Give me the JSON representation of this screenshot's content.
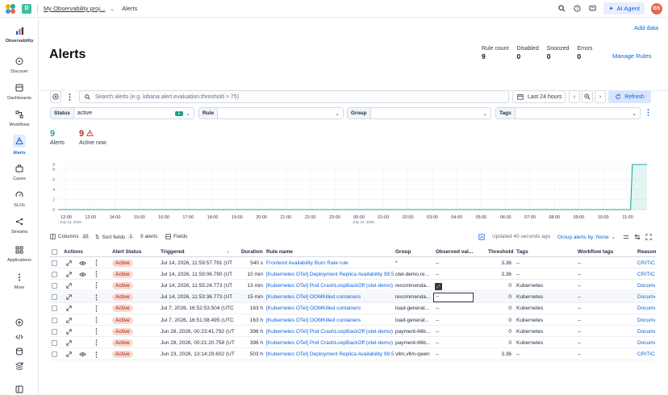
{
  "header": {
    "space_badge": "D",
    "project": "My Observability proj...",
    "breadcrumb": "Alerts",
    "ai_button": "AI Agent",
    "avatar": "BS"
  },
  "sidenav": {
    "items": [
      {
        "label": "Observability",
        "icon": "observability-icon"
      },
      {
        "label": "Discover",
        "icon": "discover-icon"
      },
      {
        "label": "Dashboards",
        "icon": "dashboards-icon"
      },
      {
        "label": "Workflows",
        "icon": "workflows-icon"
      },
      {
        "label": "Alerts",
        "icon": "alerts-icon"
      },
      {
        "label": "Cases",
        "icon": "cases-icon"
      },
      {
        "label": "SLOs",
        "icon": "slos-icon"
      },
      {
        "label": "Streams",
        "icon": "streams-icon"
      },
      {
        "label": "Applications",
        "icon": "applications-icon"
      },
      {
        "label": "More",
        "icon": "more-icon"
      }
    ]
  },
  "page": {
    "add_data": "Add data",
    "title": "Alerts",
    "stats": [
      {
        "label": "Rule count",
        "value": "9"
      },
      {
        "label": "Disabled",
        "value": "0"
      },
      {
        "label": "Snoozed",
        "value": "0"
      },
      {
        "label": "Errors",
        "value": "0"
      }
    ],
    "manage_rules": "Manage Rules"
  },
  "search": {
    "placeholder": "Search alerts (e.g. kibana.alert.evaluation.threshold > 75)",
    "date_range": "Last 24 hours",
    "refresh": "Refresh"
  },
  "filters": {
    "status_label": "Status",
    "status_value": "active",
    "status_count": "1",
    "rule_label": "Rule",
    "group_label": "Group",
    "tags_label": "Tags"
  },
  "summary": {
    "alerts_value": "9",
    "alerts_label": "Alerts",
    "active_value": "9",
    "active_label": "Active now",
    "alerts_color": "#1ba9a0",
    "active_color": "#bd271e"
  },
  "chart_data": {
    "type": "area",
    "x_ticks": [
      "12:00",
      "13:00",
      "14:00",
      "15:00",
      "16:00",
      "17:00",
      "18:00",
      "19:00",
      "20:00",
      "21:00",
      "22:00",
      "23:00",
      "00:00",
      "01:00",
      "02:00",
      "03:00",
      "04:00",
      "05:00",
      "06:00",
      "07:00",
      "08:00",
      "09:00",
      "10:00",
      "11:00"
    ],
    "x_subticks": [
      "July 13, 2026",
      "July 14, 2026"
    ],
    "y_ticks": [
      0,
      2,
      4,
      6,
      8,
      9
    ],
    "ylim": [
      0,
      9
    ],
    "series": [
      {
        "color": "#1ba9a0",
        "points": [
          [
            0,
            0
          ],
          [
            0.955,
            0
          ],
          [
            0.96,
            0
          ],
          [
            0.972,
            0
          ],
          [
            0.975,
            9
          ],
          [
            1,
            9
          ]
        ]
      }
    ],
    "grid": true
  },
  "toolbar": {
    "columns_label": "Columns",
    "columns_count": "10",
    "sort_label": "Sort fields",
    "sort_count": "1",
    "alerts_count": "9 alerts",
    "fields_label": "Fields",
    "updated": "Updated 40 seconds ago",
    "group_by": "Group alerts by: None"
  },
  "table": {
    "headers": {
      "actions": "Actions",
      "status": "Alert Status",
      "triggered": "Triggered",
      "duration": "Duration",
      "rule": "Rule name",
      "group": "Group",
      "observed": "Observed val...",
      "threshold": "Threshold",
      "tags": "Tags",
      "wf_tags": "Workflow tags",
      "reason": "Reason"
    },
    "rows": [
      {
        "status": "Active",
        "triggered": "Jul 14, 2026, 11:59:57.791 (UT",
        "duration": "540 s",
        "rule": "Frontend Availability Burn Rate rule",
        "group": "*",
        "observed": "--",
        "threshold": "3.36",
        "tags": "--",
        "wf_tags": "--",
        "reason": "CRITICA",
        "eye": true
      },
      {
        "status": "Active",
        "triggered": "Jul 14, 2026, 11:59:06.790 (UT",
        "duration": "10 min",
        "rule": "[Kubernetes OTel] Deployment Replica Availability 99.5",
        "group": "otel-demo,re...",
        "observed": "--",
        "threshold": "3.36",
        "tags": "--",
        "wf_tags": "--",
        "reason": "CRITICA",
        "eye": true
      },
      {
        "status": "Active",
        "triggered": "Jul 14, 2026, 11:55:24.773 (UT",
        "duration": "13 min",
        "rule": "[Kubernetes OTel] Pod CrashLoopBackOff (otel-demo)",
        "group": "recommenda...",
        "observed": "",
        "threshold": "0",
        "tags": "Kubernetes",
        "wf_tags": "--",
        "reason": "Docume",
        "eye": false
      },
      {
        "status": "Active",
        "triggered": "Jul 14, 2026, 11:53:36.773 (UT",
        "duration": "15 min",
        "rule": "[Kubernetes OTel] OOMKilled containers",
        "group": "recommenda...",
        "observed": "--",
        "threshold": "0",
        "tags": "Kubernetes",
        "wf_tags": "--",
        "reason": "Docume",
        "eye": false
      },
      {
        "status": "Active",
        "triggered": "Jul 7, 2026, 16:52:53.504 (UTC",
        "duration": "163 h",
        "rule": "[Kubernetes OTel] OOMKilled containers",
        "group": "load-generat...",
        "observed": "--",
        "threshold": "0",
        "tags": "Kubernetes",
        "wf_tags": "--",
        "reason": "Docume",
        "eye": false
      },
      {
        "status": "Active",
        "triggered": "Jul 7, 2026, 16:51:08.495 (UTC",
        "duration": "163 h",
        "rule": "[Kubernetes OTel] OOMKilled containers",
        "group": "load-generat...",
        "observed": "--",
        "threshold": "0",
        "tags": "Kubernetes",
        "wf_tags": "--",
        "reason": "Docume",
        "eye": false
      },
      {
        "status": "Active",
        "triggered": "Jun 28, 2026, 00:23:41.792 (UT",
        "duration": "396 h",
        "rule": "[Kubernetes OTel] Pod CrashLoopBackOff (otel-demo)",
        "group": "payment-66b...",
        "observed": "--",
        "threshold": "0",
        "tags": "Kubernetes",
        "wf_tags": "--",
        "reason": "Docume",
        "eye": false
      },
      {
        "status": "Active",
        "triggered": "Jun 28, 2026, 00:21:20.758 (UT",
        "duration": "396 h",
        "rule": "[Kubernetes OTel] Pod CrashLoopBackOff (otel-demo)",
        "group": "payment-66b...",
        "observed": "--",
        "threshold": "0",
        "tags": "Kubernetes",
        "wf_tags": "--",
        "reason": "Docume",
        "eye": false
      },
      {
        "status": "Active",
        "triggered": "Jun 23, 2026, 13:14:29.602 (UT",
        "duration": "503 h",
        "rule": "[Kubernetes OTel] Deployment Replica Availability 99.5",
        "group": "vllm,vllm-qwen",
        "observed": "--",
        "threshold": "3.36",
        "tags": "--",
        "wf_tags": "--",
        "reason": "CRITICA",
        "eye": true
      }
    ]
  }
}
